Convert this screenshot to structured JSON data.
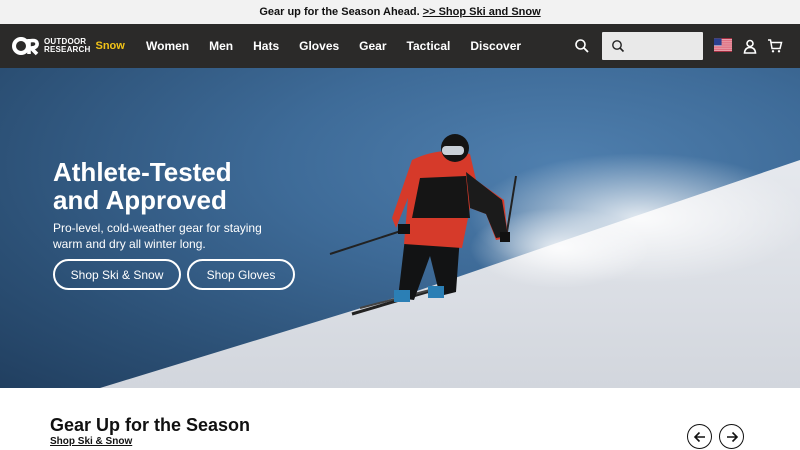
{
  "announcement": {
    "text": "Gear up for the Season Ahead.",
    "link_label": ">> Shop Ski and Snow"
  },
  "brand": {
    "line1": "OUTDOOR",
    "line2": "RESEARCH",
    "sub_brand": "Snow",
    "accent_color": "#f2c318"
  },
  "nav": {
    "items": [
      "Women",
      "Men",
      "Hats",
      "Gloves",
      "Gear",
      "Tactical",
      "Discover"
    ],
    "search_placeholder": "",
    "icons": [
      "search-icon",
      "us-flag-icon",
      "user-icon",
      "cart-icon"
    ]
  },
  "hero": {
    "title_line1": "Athlete-Tested",
    "title_line2": "and Approved",
    "subtitle": "Pro-level, cold-weather gear for staying warm and dry all winter long.",
    "buttons": [
      "Shop Ski & Snow",
      "Shop Gloves"
    ]
  },
  "section": {
    "title": "Gear Up for the Season",
    "link_label": "Shop Ski & Snow"
  }
}
